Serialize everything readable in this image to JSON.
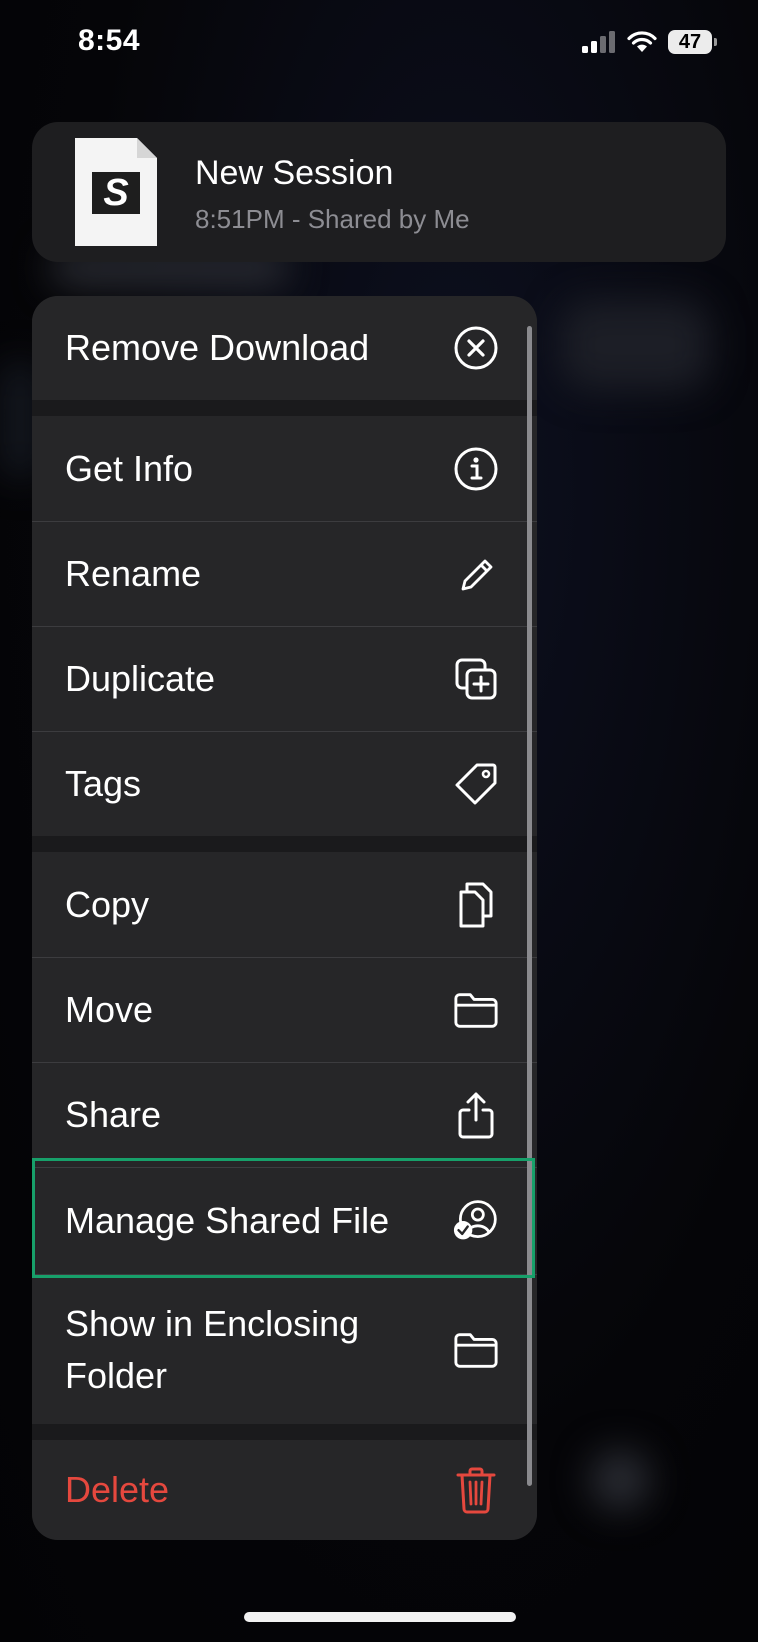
{
  "status_bar": {
    "time": "8:54",
    "battery": "47"
  },
  "preview": {
    "title": "New Session",
    "subtitle": "8:51PM - Shared by Me",
    "thumb_letter": "S"
  },
  "menu": {
    "remove_download": "Remove Download",
    "get_info": "Get Info",
    "rename": "Rename",
    "duplicate": "Duplicate",
    "tags": "Tags",
    "copy": "Copy",
    "move": "Move",
    "share": "Share",
    "manage_shared_file": "Manage Shared File",
    "show_in_enclosing_folder_line1": "Show in Enclosing",
    "show_in_enclosing_folder_line2": "Folder",
    "delete": "Delete"
  },
  "colors": {
    "destructive": "#e5483e",
    "highlight": "#17a06a",
    "menu_bg": "#262628"
  },
  "icons": {
    "remove_download": "xmark-circle-icon",
    "get_info": "info-circle-icon",
    "rename": "pencil-icon",
    "duplicate": "plus-square-on-square-icon",
    "tags": "tag-icon",
    "copy": "doc-on-doc-icon",
    "move": "folder-icon",
    "share": "share-icon",
    "manage_shared_file": "person-crop-circle-badge-checkmark-icon",
    "show_in_enclosing_folder": "folder-icon",
    "delete": "trash-icon"
  }
}
